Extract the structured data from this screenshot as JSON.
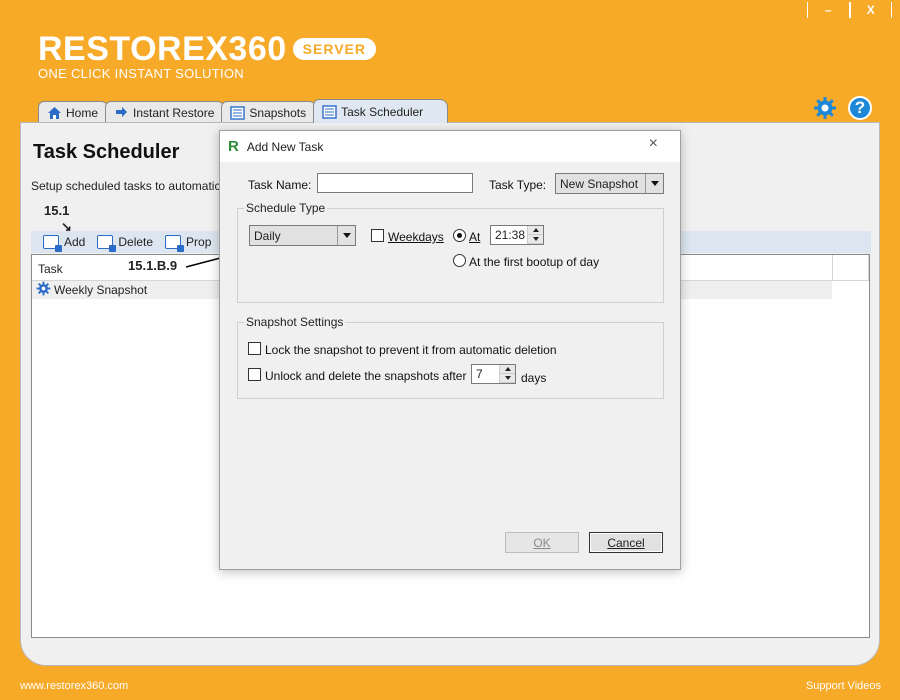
{
  "window": {
    "minimize": "–",
    "close": "X"
  },
  "logo": {
    "main": "RESTOREX360",
    "badge": "SERVER",
    "tagline": "ONE CLICK INSTANT SOLUTION"
  },
  "tabs": [
    {
      "label": "Home",
      "icon": "home-icon"
    },
    {
      "label": "Instant Restore",
      "icon": "instant-restore-icon"
    },
    {
      "label": "Snapshots",
      "icon": "snapshots-icon"
    },
    {
      "label": "Task Scheduler",
      "icon": "task-scheduler-icon",
      "active": true
    }
  ],
  "page": {
    "title": "Task Scheduler",
    "description": "Setup scheduled tasks to automatically"
  },
  "annotations": {
    "add": "15.1",
    "arrow": "↘",
    "dropdown": "15.1.B.9"
  },
  "toolbar": {
    "add": "Add",
    "delete": "Delete",
    "properties": "Prop"
  },
  "list": {
    "column_task": "Task",
    "rows": [
      {
        "label": "Weekly Snapshot",
        "icon": "gear-icon"
      }
    ]
  },
  "footer": {
    "website": "www.restorex360.com",
    "support": "Support Videos"
  },
  "dialog": {
    "title": "Add New Task",
    "logo_letter": "R",
    "close": "×",
    "task_name_label": "Task Name:",
    "task_name_value": "",
    "task_type_label": "Task Type:",
    "task_type_value": "New Snapshot",
    "schedule_type": {
      "title": "Schedule Type",
      "frequency": "Daily",
      "weekdays_label": "Weekdays",
      "weekdays_checked": false,
      "at_label": "At",
      "at_selected": true,
      "at_time": "21:38",
      "first_bootup_label": "At the first bootup of day",
      "first_bootup_selected": false
    },
    "snapshot_settings": {
      "title": "Snapshot Settings",
      "lock_label": "Lock the snapshot to prevent it from automatic deletion",
      "lock_checked": false,
      "unlock_label": "Unlock and delete the snapshots after",
      "unlock_checked": false,
      "days_value": "7",
      "days_label": "days"
    },
    "ok": "OK",
    "cancel": "Cancel"
  },
  "colors": {
    "brand_orange": "#f7a928",
    "accent_blue": "#1e88d8",
    "toolbar_blue": "#dde6f0"
  }
}
